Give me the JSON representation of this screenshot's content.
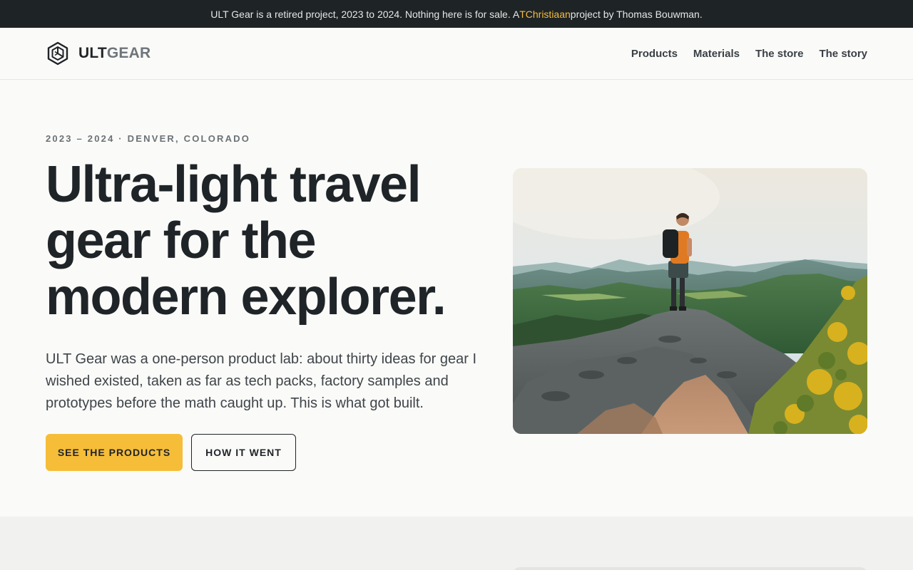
{
  "announcement": {
    "before": "ULT Gear is a retired project, 2023 to 2024. Nothing here is for sale. A ",
    "link": "TChristiaan",
    "after": " project by Thomas Bouwman."
  },
  "brand": {
    "name_strong": "ULT",
    "name_light": "GEAR"
  },
  "nav": [
    "Products",
    "Materials",
    "The store",
    "The story"
  ],
  "hero": {
    "eyebrow": "2023 – 2024 · DENVER, COLORADO",
    "headline": "Ultra-light travel gear for the modern explorer.",
    "intro": "ULT Gear was a one-person product lab: about thirty ideas for gear I wished existed, taken as far as tech packs, factory samples and prototypes before the math caught up. This is what got built.",
    "primary_button": "SEE THE PRODUCTS",
    "secondary_button": "HOW IT WENT"
  },
  "colors": {
    "accent": "#f6bd38",
    "dark": "#1e2326",
    "text": "#1f2428",
    "muted": "#6b7276"
  }
}
